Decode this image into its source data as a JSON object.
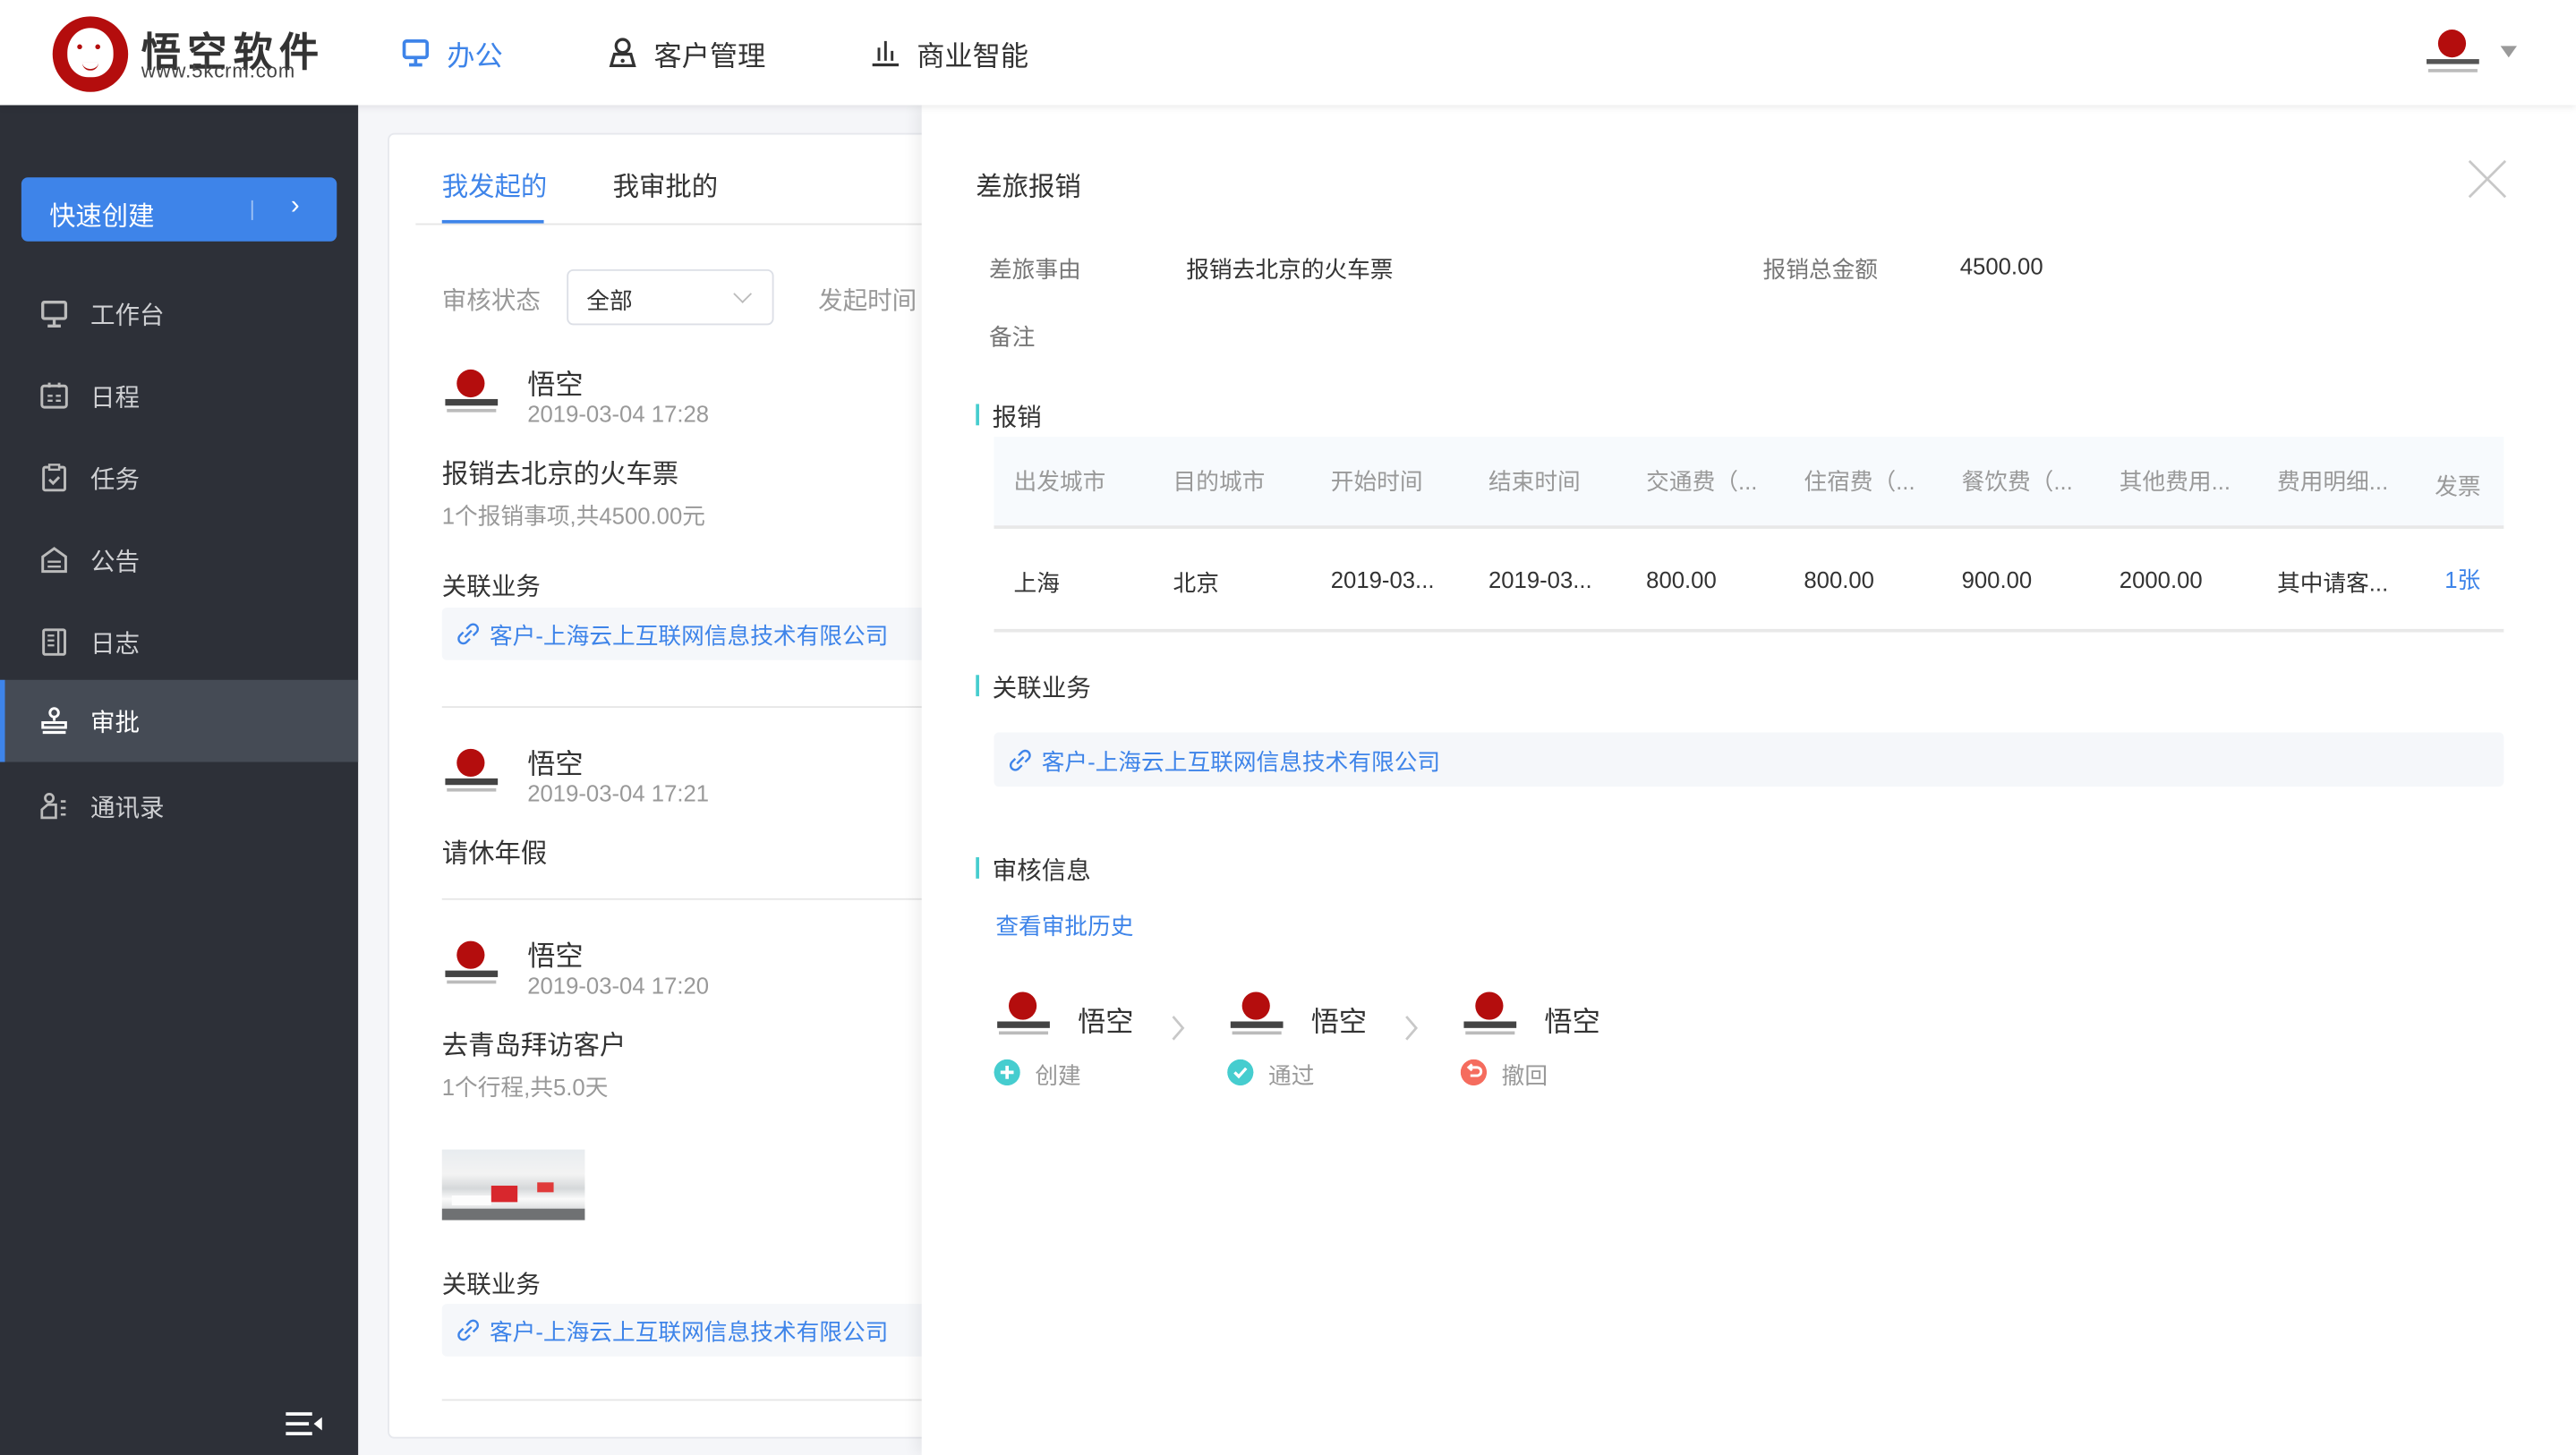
{
  "header": {
    "logo_title": "悟空软件",
    "logo_url": "www.5kcrm.com",
    "nav": [
      {
        "label": "办公",
        "icon": "monitor-icon",
        "active": true
      },
      {
        "label": "客户管理",
        "icon": "customer-icon",
        "active": false
      },
      {
        "label": "商业智能",
        "icon": "bar-chart-icon",
        "active": false
      }
    ],
    "avatar_icon": "wukong-logo-avatar",
    "dropdown_icon": "caret-down-icon"
  },
  "sidebar": {
    "quick_create": "快速创建",
    "quick_create_arrow": "›",
    "items": [
      {
        "label": "工作台",
        "icon": "monitor-icon",
        "active": false
      },
      {
        "label": "日程",
        "icon": "calendar-icon",
        "active": false
      },
      {
        "label": "任务",
        "icon": "task-icon",
        "active": false
      },
      {
        "label": "公告",
        "icon": "announcement-icon",
        "active": false
      },
      {
        "label": "日志",
        "icon": "log-icon",
        "active": false
      },
      {
        "label": "审批",
        "icon": "stamp-icon",
        "active": true
      },
      {
        "label": "通讯录",
        "icon": "contacts-icon",
        "active": false
      }
    ],
    "collapse_icon": "collapse-menu-icon"
  },
  "list_panel": {
    "tabs": [
      {
        "label": "我发起的",
        "active": true
      },
      {
        "label": "我审批的",
        "active": false
      }
    ],
    "filters": {
      "status_label": "审核状态",
      "status_value": "全部",
      "time_label": "发起时间"
    },
    "items": [
      {
        "name": "悟空",
        "time": "2019-03-04 17:28",
        "title": "报销去北京的火车票",
        "subtitle": "1个报销事项,共4500.00元",
        "related_label": "关联业务",
        "related": "客户-上海云上互联网信息技术有限公司"
      },
      {
        "name": "悟空",
        "time": "2019-03-04 17:21",
        "title": "请休年假"
      },
      {
        "name": "悟空",
        "time": "2019-03-04 17:20",
        "title": "去青岛拜访客户",
        "subtitle": "1个行程,共5.0天",
        "has_image": true,
        "related_label": "关联业务",
        "related": "客户-上海云上互联网信息技术有限公司"
      }
    ]
  },
  "drawer": {
    "title": "差旅报销",
    "fields": [
      {
        "label": "差旅事由",
        "value": "报销去北京的火车票"
      },
      {
        "label": "报销总金额",
        "value": "4500.00"
      },
      {
        "label": "备注",
        "value": ""
      }
    ],
    "reimburse_section": "报销",
    "table": {
      "columns": [
        "出发城市",
        "目的城市",
        "开始时间",
        "结束时间",
        "交通费（...",
        "住宿费（...",
        "餐饮费（...",
        "其他费用...",
        "费用明细...",
        "发票"
      ],
      "rows": [
        [
          "上海",
          "北京",
          "2019-03...",
          "2019-03...",
          "800.00",
          "800.00",
          "900.00",
          "2000.00",
          "其中请客...",
          "1张"
        ]
      ]
    },
    "related_section": "关联业务",
    "related": "客户-上海云上互联网信息技术有限公司",
    "audit_section": "审核信息",
    "history_link": "查看审批历史",
    "flow": [
      {
        "name": "悟空",
        "status": "创建",
        "status_icon": "plus-circle-icon",
        "color": "#46cdcf"
      },
      {
        "name": "悟空",
        "status": "通过",
        "status_icon": "check-circle-icon",
        "color": "#46cdcf"
      },
      {
        "name": "悟空",
        "status": "撤回",
        "status_icon": "undo-circle-icon",
        "color": "#f56c5e"
      }
    ]
  },
  "colors": {
    "primary": "#3e84e9",
    "sidebar_bg": "#2d3038",
    "section_accent": "#46cdcf",
    "revoke": "#f56c5e",
    "logo_red": "#b40d0d"
  }
}
